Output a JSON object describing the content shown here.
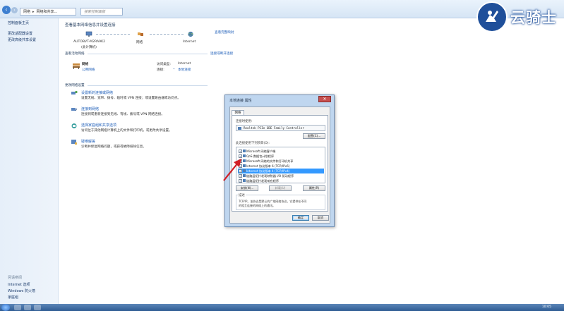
{
  "address": {
    "crumb1": "网络",
    "crumb2": "网络和共享...",
    "search_placeholder": "搜索控制面板"
  },
  "watermark": {
    "text": "云骑士"
  },
  "left_pane": {
    "home": "控制面板主页",
    "links": [
      "更改适配器设置",
      "更改高级共享设置"
    ],
    "see_also_head": "另请参阅",
    "see_also": [
      "Internet 选项",
      "Windows 防火墙",
      "家庭组"
    ]
  },
  "main": {
    "title": "查看基本网络信息并设置连接",
    "full_map_link": "查看完整映射",
    "map_nodes": [
      {
        "label": "AUTOBVT-M2RA9K2",
        "sub": "(此计算机)"
      },
      {
        "label": "网络",
        "sub": ""
      },
      {
        "label": "Internet",
        "sub": ""
      }
    ],
    "active_networks_head": "查看活动网络",
    "connect_link": "连接或断开连接",
    "network_name": "网络",
    "network_type": "公用网络",
    "access_type_label": "访问类型:",
    "access_type_value": "Internet",
    "connections_label": "连接:",
    "connections_value": "本地连接",
    "change_settings_head": "更改网络设置",
    "tasks": [
      {
        "title": "设置新的连接或网络",
        "desc": "设置无线、宽带、拨号、临时或 VPN 连接；或设置路由器或访问点。"
      },
      {
        "title": "连接到网络",
        "desc": "连接到或重新连接到无线、有线、拨号或 VPN 网络连接。"
      },
      {
        "title": "选择家庭组和共享选项",
        "desc": "访问位于其他网络计算机上的文件和打印机，或更改共享设置。"
      },
      {
        "title": "疑难解答",
        "desc": "诊断并修复网络问题，或获得故障排除信息。"
      }
    ]
  },
  "dialog": {
    "title": "本地连接 属性",
    "close_glyph": "✕",
    "tab": "网络",
    "connect_using_label": "连接时使用:",
    "adapter": "Realtek PCIe GBE Family Controller",
    "configure_button": "配置(C)...",
    "items_label": "此连接使用下列项目(O):",
    "items": [
      {
        "text": "Microsoft 网络客户端",
        "checked": true,
        "selected": false
      },
      {
        "text": "QoS 数据包计划程序",
        "checked": true,
        "selected": false
      },
      {
        "text": "Microsoft 网络的文件和打印机共享",
        "checked": true,
        "selected": false
      },
      {
        "text": "Internet 协议版本 6 (TCP/IPv6)",
        "checked": true,
        "selected": false
      },
      {
        "text": "Internet 协议版本 4 (TCP/IPv4)",
        "checked": true,
        "selected": true
      },
      {
        "text": "链路层拓扑发现映射器 I/O 驱动程序",
        "checked": true,
        "selected": false
      },
      {
        "text": "链路层拓扑发现响应程序",
        "checked": true,
        "selected": false
      }
    ],
    "install_button": "安装(N)...",
    "uninstall_button": "卸载(U)",
    "properties_button": "属性(R)",
    "desc_head": "描述",
    "desc_text_1": "TCP/IP。该协议是默认的广域网络协议，它提供在不同",
    "desc_text_2": "的相互连接的网络上的通讯。",
    "ok_button": "确定",
    "cancel_button": "取消"
  },
  "taskbar": {
    "clock": "10:05"
  },
  "colors": {
    "accent": "#1f5fb9",
    "selection": "#3399ff",
    "dialog_frame": "#bfd6ef"
  }
}
